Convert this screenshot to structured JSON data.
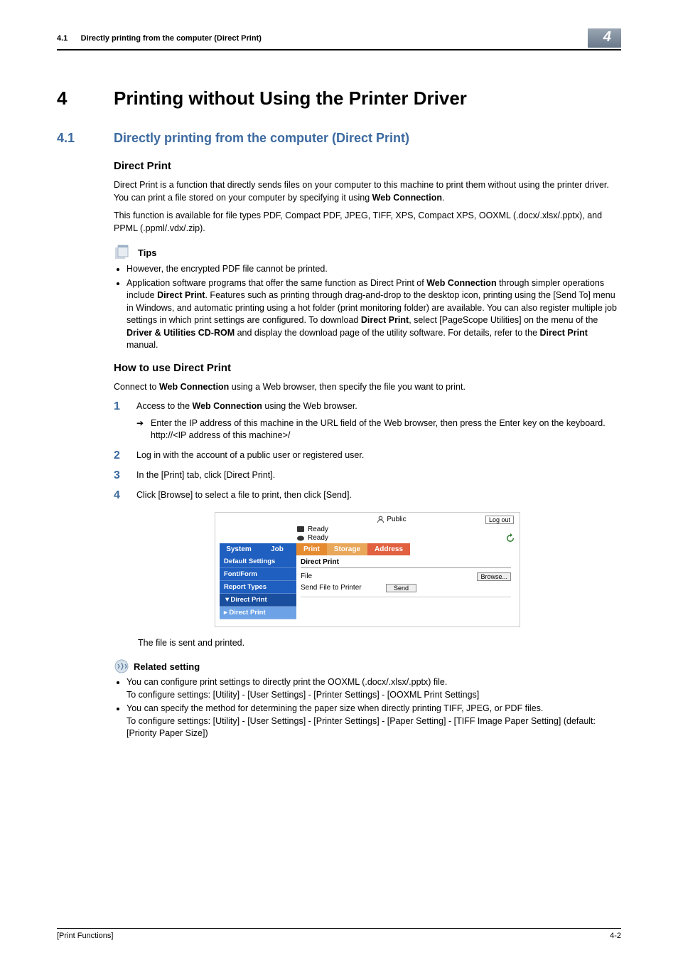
{
  "header": {
    "section_num": "4.1",
    "section_title": "Directly printing from the computer (Direct Print)",
    "chapter_badge": "4"
  },
  "chapter": {
    "num": "4",
    "title": "Printing without Using the Printer Driver"
  },
  "section": {
    "num": "4.1",
    "title": "Directly printing from the computer (Direct Print)"
  },
  "direct_print": {
    "heading": "Direct Print",
    "p1_a": "Direct Print is a function that directly sends files on your computer to this machine to print them without using the printer driver. You can print a file stored on your computer by specifying it using ",
    "p1_bold": "Web Connection",
    "p1_b": ".",
    "p2": "This function is available for file types PDF, Compact PDF, JPEG, TIFF, XPS, Compact XPS, OOXML (.docx/.xlsx/.pptx), and PPML (.ppml/.vdx/.zip)."
  },
  "tips": {
    "label": "Tips",
    "b1": "However, the encrypted PDF file cannot be printed.",
    "b2_a": "Application software programs that offer the same function as Direct Print of ",
    "b2_bold1": "Web Connection",
    "b2_b": " through simpler operations include ",
    "b2_bold2": "Direct Print",
    "b2_c": ". Features such as printing through drag-and-drop to the desktop icon, printing using the [Send To] menu in Windows, and automatic printing using a hot folder (print monitoring folder) are available. You can also register multiple job settings in which print settings are configured. To download ",
    "b2_bold3": "Direct Print",
    "b2_d": ", select [PageScope Utilities] on the menu of the ",
    "b2_bold4": "Driver & Utilities CD-ROM",
    "b2_e": " and display the download page of the utility software. For details, refer to the ",
    "b2_bold5": "Direct Print",
    "b2_f": " manual."
  },
  "howto": {
    "heading": "How to use Direct Print",
    "intro_a": "Connect to ",
    "intro_bold": "Web Connection",
    "intro_b": " using a Web browser, then specify the file you want to print.",
    "steps": [
      {
        "num": "1",
        "text_a": "Access to the ",
        "text_bold": "Web Connection",
        "text_b": " using the Web browser.",
        "sub1": "Enter the IP address of this machine in the URL field of the Web browser, then press the Enter key on the keyboard.",
        "sub2": "http://<IP address of this machine>/"
      },
      {
        "num": "2",
        "text": "Log in with the account of a public user or registered user."
      },
      {
        "num": "3",
        "text": "In the [Print] tab, click [Direct Print]."
      },
      {
        "num": "4",
        "text": "Click [Browse] to select a file to print, then click [Send]."
      }
    ],
    "after_img": "The file is sent and printed."
  },
  "embed": {
    "user": "Public",
    "logout": "Log out",
    "ready1": "Ready",
    "ready2": "Ready",
    "side_tabs": [
      "System",
      "Job"
    ],
    "main_tabs": [
      "Print",
      "Storage",
      "Address"
    ],
    "sidebar": [
      "Default Settings",
      "Font/Form",
      "Report Types",
      "▼Direct Print",
      "▸ Direct Print"
    ],
    "panel_title": "Direct Print",
    "row1_label": "File",
    "browse": "Browse...",
    "row2_label": "Send File to Printer",
    "send": "Send"
  },
  "related": {
    "label": "Related setting",
    "b1a": "You can configure print settings to directly print the OOXML (.docx/.xlsx/.pptx) file.",
    "b1b": "To configure settings: [Utility] - [User Settings] - [Printer Settings] - [OOXML Print Settings]",
    "b2a": "You can specify the method for determining the paper size when directly printing TIFF, JPEG, or PDF files.",
    "b2b": "To configure settings: [Utility] - [User Settings] - [Printer Settings] - [Paper Setting] - [TIFF Image Paper Setting] (default: [Priority Paper Size])"
  },
  "footer": {
    "left": "[Print Functions]",
    "right": "4-2"
  }
}
